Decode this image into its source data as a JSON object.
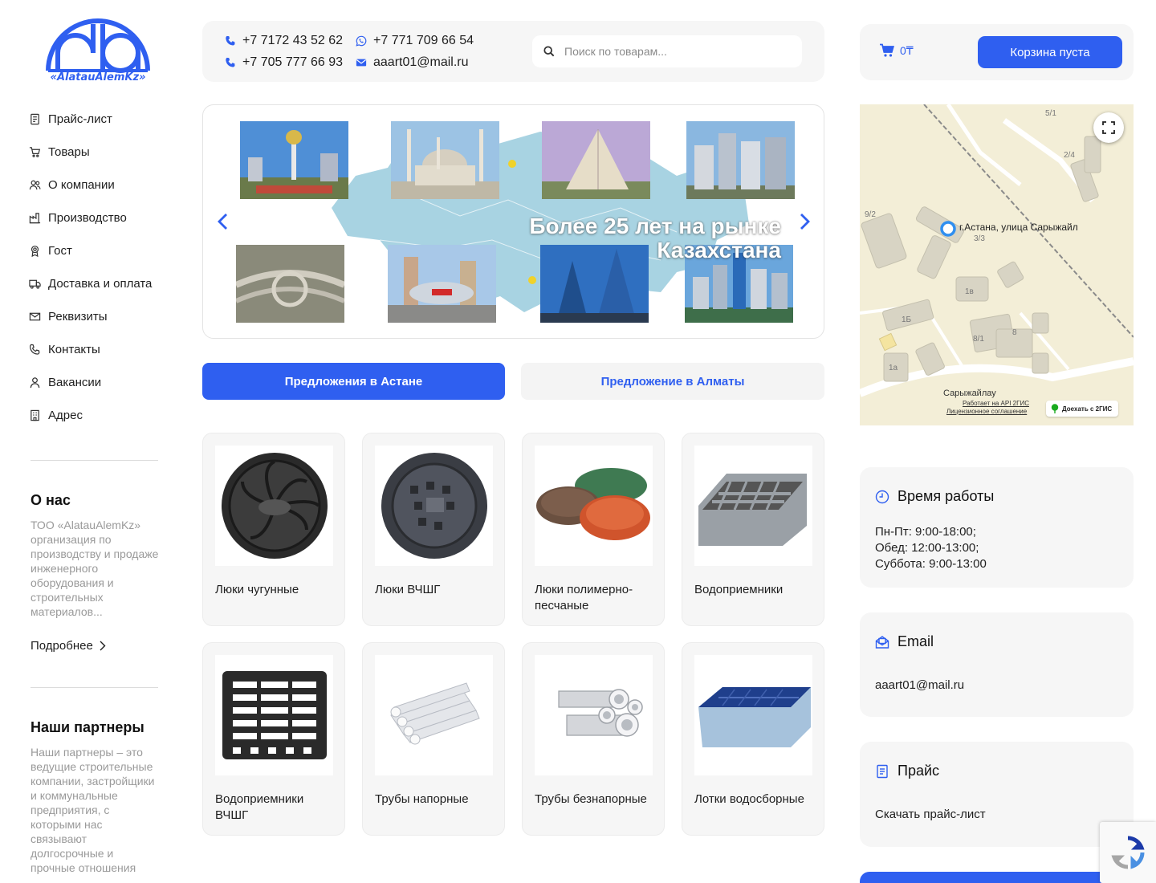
{
  "brand": {
    "logo_text": "«AlatauAlemKz»",
    "accent": "#2f5ff0"
  },
  "menu": [
    {
      "label": "Прайс-лист",
      "icon": "document-icon"
    },
    {
      "label": "Товары",
      "icon": "cart-icon"
    },
    {
      "label": "О компании",
      "icon": "people-icon"
    },
    {
      "label": "Производство",
      "icon": "factory-icon"
    },
    {
      "label": "Гост",
      "icon": "award-icon"
    },
    {
      "label": "Доставка и оплата",
      "icon": "truck-icon"
    },
    {
      "label": "Реквизиты",
      "icon": "envelope-icon"
    },
    {
      "label": "Контакты",
      "icon": "phone-icon"
    },
    {
      "label": "Вакансии",
      "icon": "user-icon"
    },
    {
      "label": "Адрес",
      "icon": "building-icon"
    }
  ],
  "about": {
    "title": "О нас",
    "text": "ТОО «AlatauAlemKz» организация по производству и продаже инженерного оборудования и строительных материалов...",
    "more_label": "Подробнее"
  },
  "partners": {
    "title": "Наши партнеры",
    "text": "Наши партнеры – это ведущие строительные компании, застройщики и коммунальные предприятия, с которыми нас связывают долгосрочные и прочные отношения"
  },
  "header": {
    "phone1": "+7 7172 43 52 62",
    "phone2": "+7 705 777 66 93",
    "whatsapp": "+7 771 709 66 54",
    "email": "aaart01@mail.ru",
    "search_placeholder": "Поиск по товарам..."
  },
  "cart": {
    "amount": "0₸",
    "button_label": "Корзина пуста"
  },
  "slider": {
    "slogan_line1": "Более 25 лет на рынке",
    "slogan_line2": "Казахстана"
  },
  "tabs": {
    "astana": "Предложения в Астане",
    "almaty": "Предложение в Алматы"
  },
  "products": [
    {
      "name": "Люки чугунные"
    },
    {
      "name": "Люки ВЧШГ"
    },
    {
      "name": "Люки полимерно-песчаные"
    },
    {
      "name": "Водоприемники"
    },
    {
      "name": "Водоприемники ВЧШГ"
    },
    {
      "name": "Трубы напорные"
    },
    {
      "name": "Трубы безнапорные"
    },
    {
      "name": "Лотки водосборные"
    }
  ],
  "map": {
    "address": "г.Астана, улица Сарыжайл",
    "street": "Сарыжайлау",
    "api_note": "Работает на API 2ГИС",
    "license": "Лицензионное соглашение",
    "route_label": "Доехать с 2ГИС",
    "labels": [
      "5/1",
      "2/4",
      "9/2",
      "3/3",
      "1в",
      "1Б",
      "8",
      "8/1",
      "1а"
    ]
  },
  "hours": {
    "title": "Время работы",
    "line1": "Пн-Пт: 9:00-18:00;",
    "line2": "Обед: 12:00-13:00;",
    "line3": "Суббота: 9:00-13:00"
  },
  "email_block": {
    "title": "Email",
    "value": "aaart01@mail.ru"
  },
  "price_block": {
    "title": "Прайс",
    "link": "Скачать прайс-лист"
  }
}
